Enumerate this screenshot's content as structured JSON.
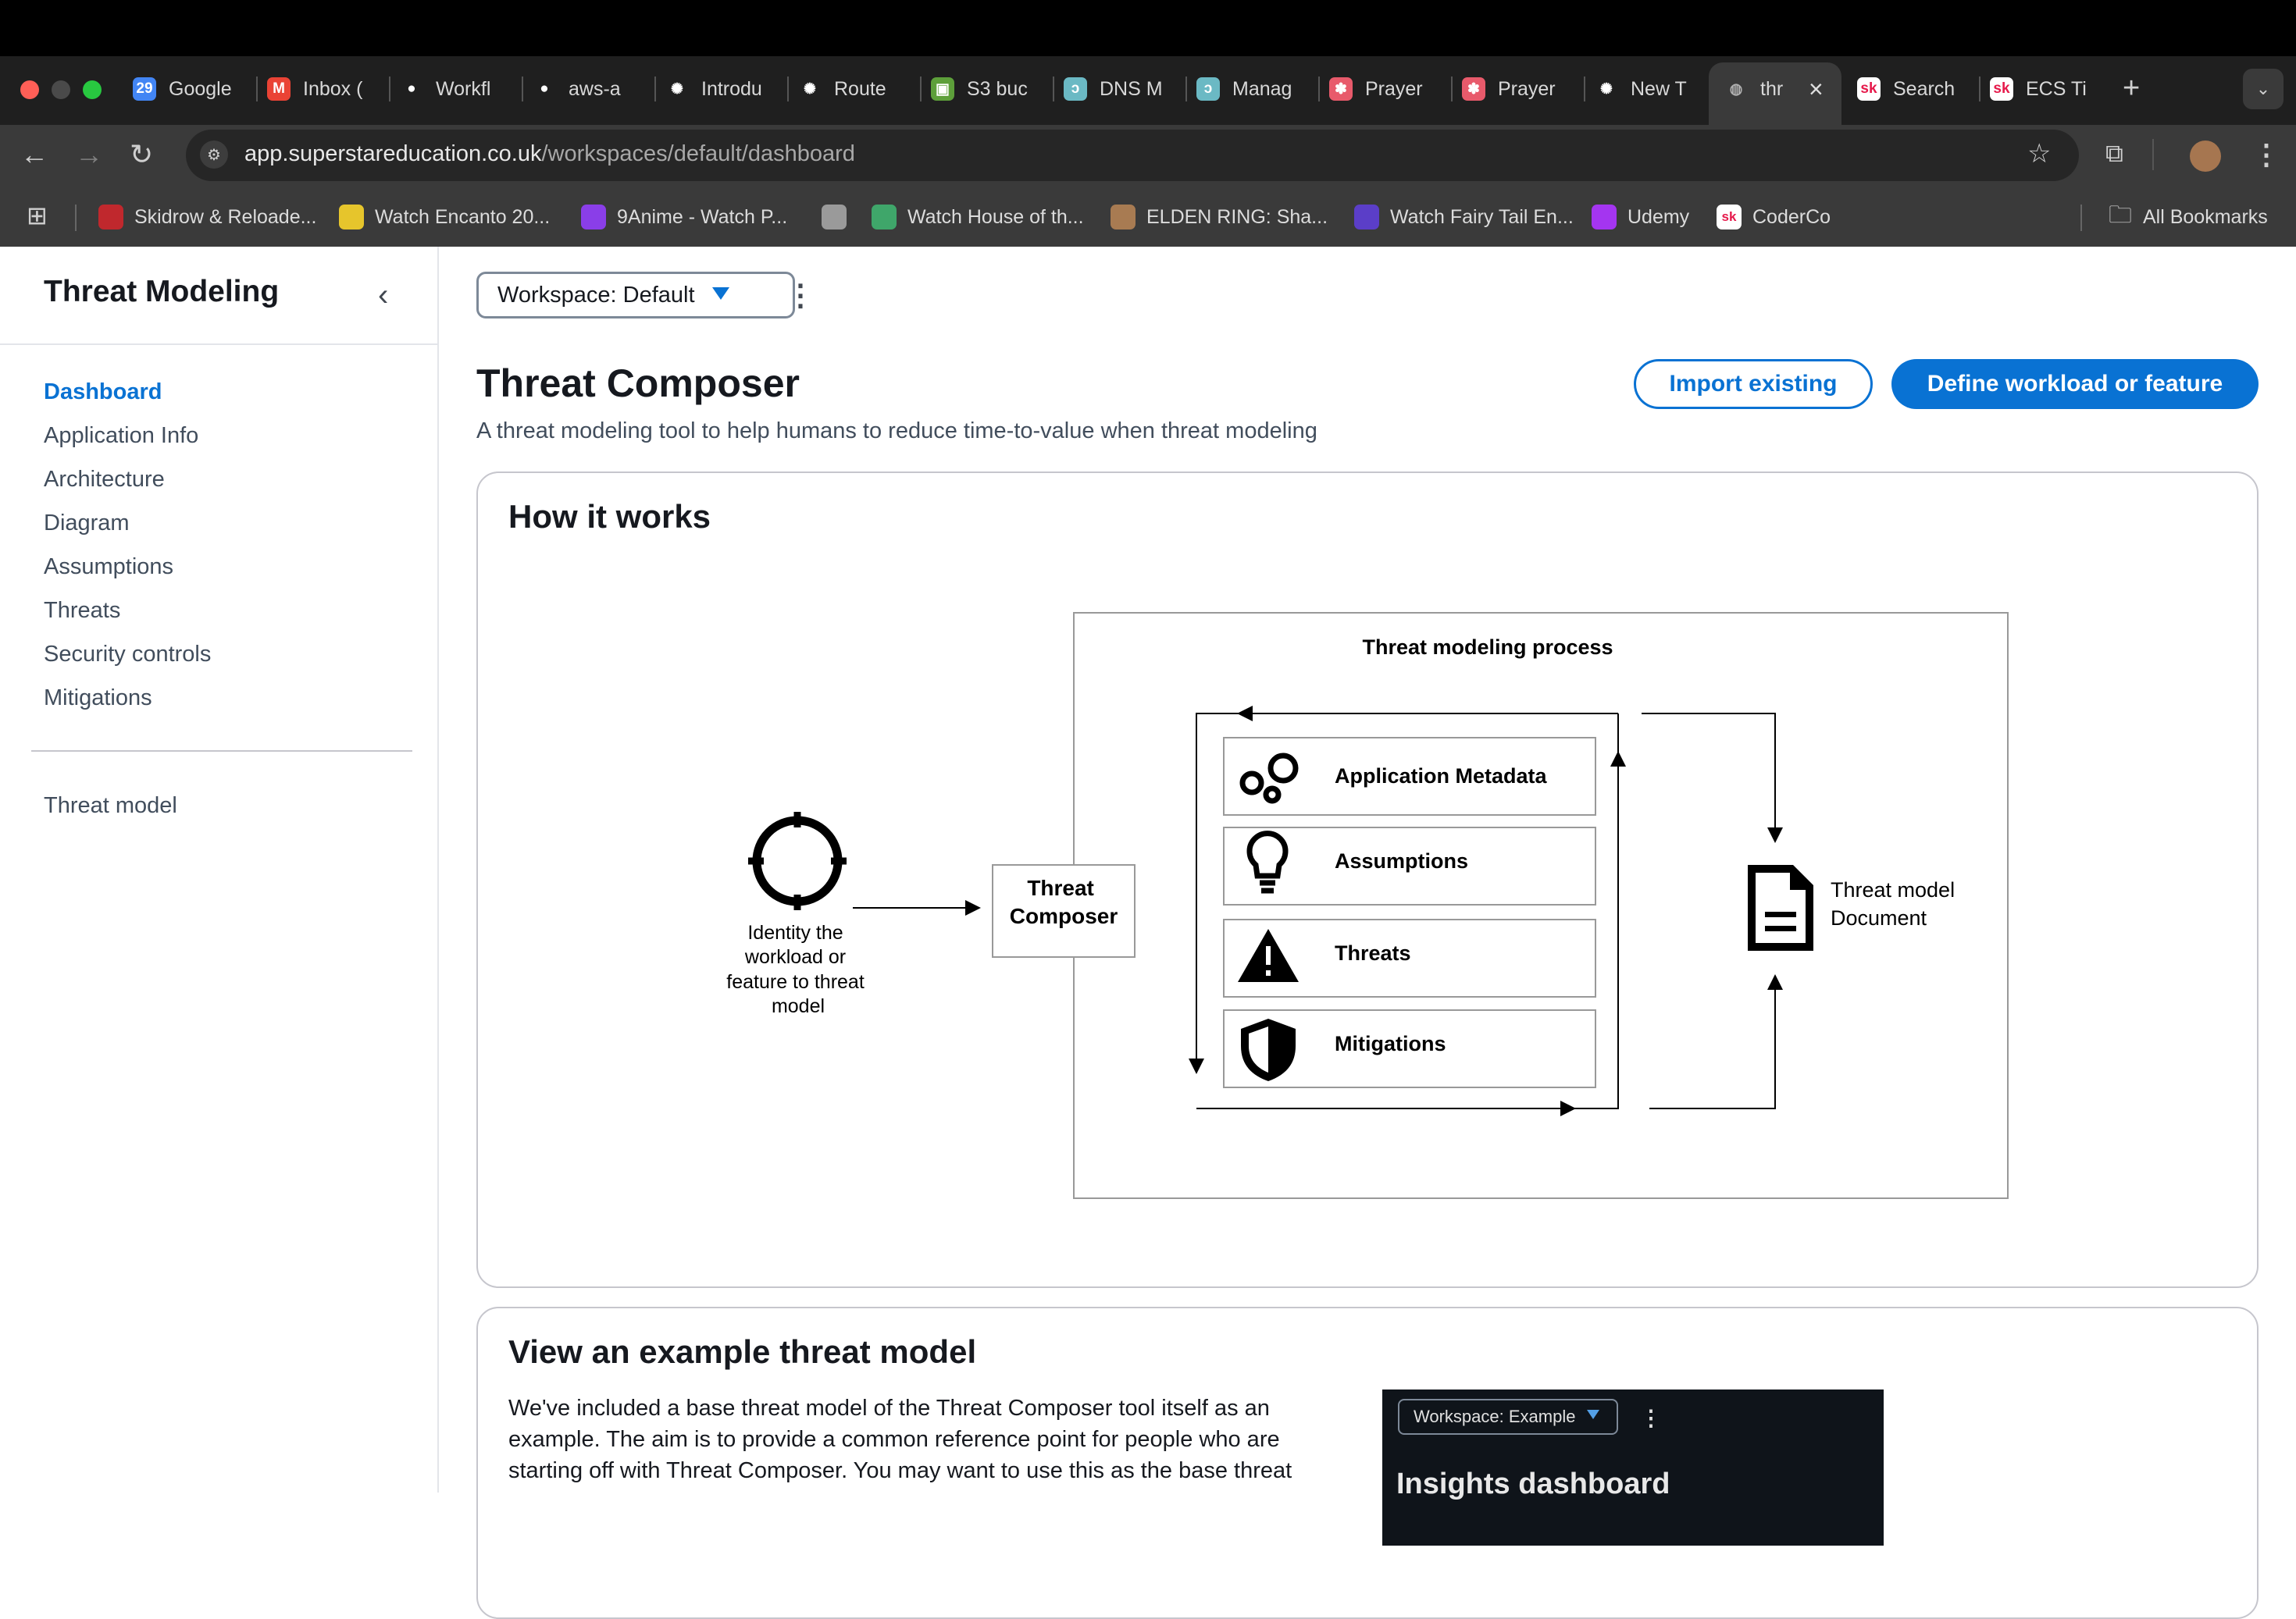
{
  "browser": {
    "tabs": [
      {
        "label": "Google",
        "icon": "google-calendar-icon",
        "color": "#4285f4",
        "glyph": "29"
      },
      {
        "label": "Inbox (",
        "icon": "gmail-icon",
        "color": "#ea4335",
        "glyph": "M"
      },
      {
        "label": "Workfl",
        "icon": "github-icon",
        "color": "#ffffff",
        "glyph": "●"
      },
      {
        "label": "aws-a",
        "icon": "github-icon",
        "color": "#ffffff",
        "glyph": "●"
      },
      {
        "label": "Introdu",
        "icon": "openai-icon",
        "color": "#ffffff",
        "glyph": "✺"
      },
      {
        "label": "Route",
        "icon": "openai-icon",
        "color": "#ffffff",
        "glyph": "✺"
      },
      {
        "label": "S3 buc",
        "icon": "aws-s3-icon",
        "color": "#5d9f3a",
        "glyph": "▣"
      },
      {
        "label": "DNS M",
        "icon": "aws-route-icon",
        "color": "#6bb9c4",
        "glyph": "ↄ"
      },
      {
        "label": "Manag",
        "icon": "aws-route-icon",
        "color": "#6bb9c4",
        "glyph": "ↄ"
      },
      {
        "label": "Prayer",
        "icon": "flower-icon",
        "color": "#e85a6b",
        "glyph": "✽"
      },
      {
        "label": "Prayer",
        "icon": "flower-icon",
        "color": "#e85a6b",
        "glyph": "✽"
      },
      {
        "label": "New T",
        "icon": "openai-icon",
        "color": "#ffffff",
        "glyph": "✺"
      },
      {
        "label": "thr",
        "icon": "globe-icon",
        "color": "#b0b0b0",
        "glyph": "◍",
        "active": true
      },
      {
        "label": "Search",
        "icon": "skyscanner-icon",
        "color": "#ffffff",
        "glyph": "sk"
      },
      {
        "label": "ECS Ti",
        "icon": "skyscanner-icon",
        "color": "#ffffff",
        "glyph": "sk"
      }
    ],
    "url_host": "app.superstareducation.co.uk",
    "url_path": "/workspaces/default/dashboard",
    "bookmarks": [
      {
        "label": "Skidrow & Reloade...",
        "icon": "deadpool-icon",
        "color": "#c0282d"
      },
      {
        "label": "Watch Encanto 20...",
        "icon": "film-icon",
        "color": "#e6c52c"
      },
      {
        "label": "9Anime - Watch P...",
        "icon": "play-triangle-icon",
        "color": "#8a3ee8"
      },
      {
        "label": "",
        "icon": "globe-icon",
        "color": "#9a9a9a"
      },
      {
        "label": "Watch House of th...",
        "icon": "play-circle-icon",
        "color": "#3fa66a"
      },
      {
        "label": "ELDEN RING: Sha...",
        "icon": "thumbnail-icon",
        "color": "#a87b52"
      },
      {
        "label": "Watch Fairy Tail En...",
        "icon": "hi-icon",
        "color": "#5b3ec8"
      },
      {
        "label": "Udemy",
        "icon": "udemy-icon",
        "color": "#a435f0"
      },
      {
        "label": "CoderCo",
        "icon": "skyscanner-icon",
        "color": "#ffffff"
      }
    ],
    "all_bookmarks": "All Bookmarks"
  },
  "sidebar": {
    "title": "Threat Modeling",
    "items": [
      {
        "label": "Dashboard",
        "active": true
      },
      {
        "label": "Application Info"
      },
      {
        "label": "Architecture"
      },
      {
        "label": "Diagram"
      },
      {
        "label": "Assumptions"
      },
      {
        "label": "Threats"
      },
      {
        "label": "Security controls"
      },
      {
        "label": "Mitigations"
      }
    ],
    "footer_item": "Threat model"
  },
  "header": {
    "workspace_select": "Workspace: Default",
    "title": "Threat Composer",
    "subtitle": "A threat modeling tool to help humans to reduce time-to-value when threat modeling",
    "import_button": "Import existing",
    "define_button": "Define workload or feature"
  },
  "how_it_works": {
    "title": "How it works",
    "diagram": {
      "process_title": "Threat modeling process",
      "identify_label": [
        "Identity the",
        "workload or",
        "feature to threat",
        "model"
      ],
      "composer_label": [
        "Threat",
        "Composer"
      ],
      "steps": [
        {
          "label": "Application Metadata",
          "icon": "circles-icon"
        },
        {
          "label": "Assumptions",
          "icon": "lightbulb-icon"
        },
        {
          "label": "Threats",
          "icon": "warning-icon"
        },
        {
          "label": "Mitigations",
          "icon": "shield-icon"
        }
      ],
      "document_label": [
        "Threat model",
        "Document"
      ]
    }
  },
  "example": {
    "title": "View an example threat model",
    "text": "We've included a base threat model of the Threat Composer tool itself as an example. The aim is to provide a common reference point for people who are starting off with Threat Composer. You may want to use this as the base threat",
    "preview_workspace": "Workspace: Example",
    "preview_title": "Insights dashboard"
  },
  "colors": {
    "accent": "#0972d3",
    "text": "#16191f",
    "secondary_text": "#414d5c"
  }
}
